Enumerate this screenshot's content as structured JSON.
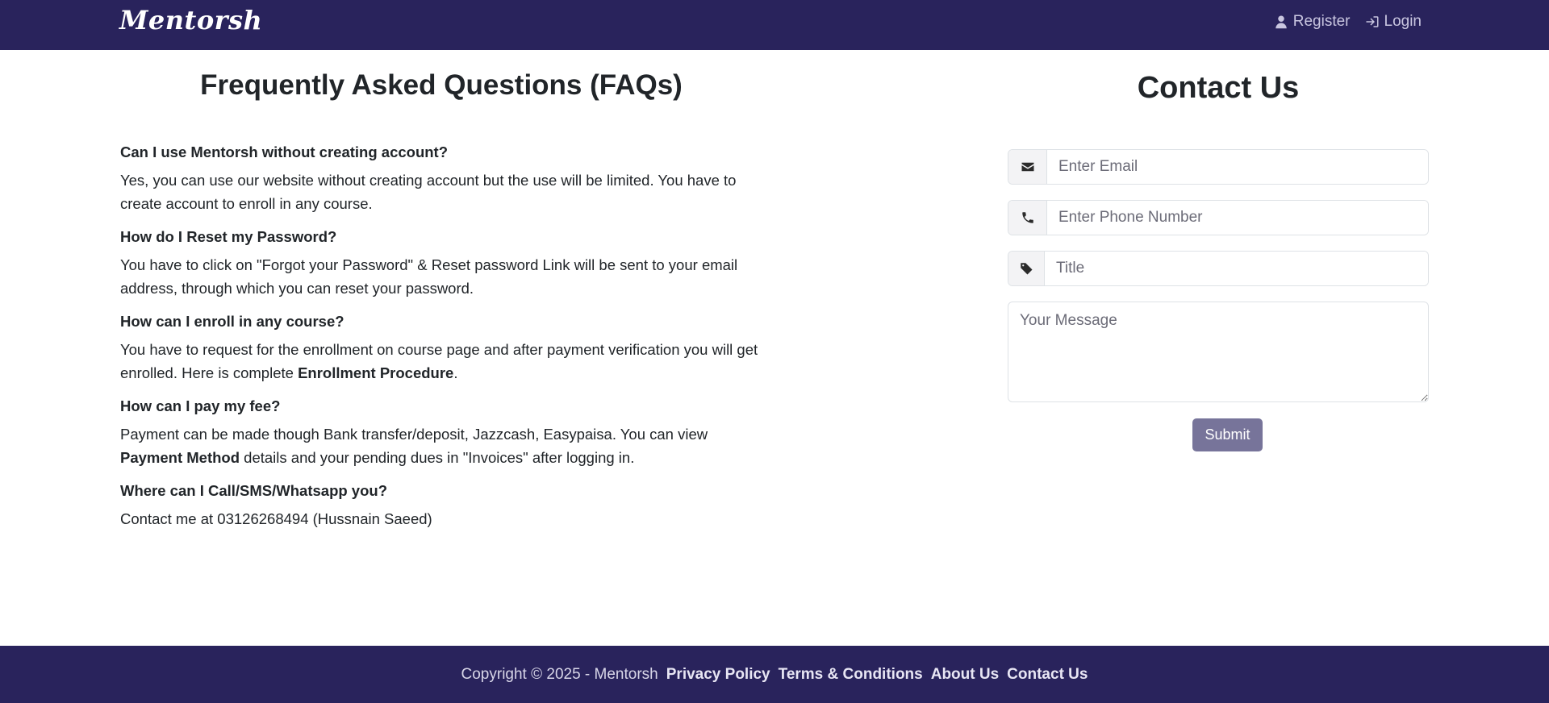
{
  "navbar": {
    "brand": "Mentorsh",
    "register_label": "Register",
    "login_label": "Login"
  },
  "faq": {
    "title": "Frequently Asked Questions (FAQs)",
    "items": [
      {
        "question": "Can I use Mentorsh without creating account?",
        "answer": "Yes, you can use our website without creating account but the use will be limited. You have to create account to enroll in any course."
      },
      {
        "question": "How do I Reset my Password?",
        "answer": "You have to click on \"Forgot your Password\" & Reset password Link will be sent to your email address, through which you can reset your password."
      },
      {
        "question": "How can I enroll in any course?",
        "answer_prefix": "You have to request for the enrollment on course page and after payment verification you will get enrolled. Here is complete ",
        "answer_link": "Enrollment Procedure",
        "answer_suffix": "."
      },
      {
        "question": "How can I pay my fee?",
        "answer_prefix": "Payment can be made though Bank transfer/deposit, Jazzcash, Easypaisa. You can view ",
        "answer_link": "Payment Method",
        "answer_suffix": " details and your pending dues in \"Invoices\" after logging in."
      },
      {
        "question": "Where can I Call/SMS/Whatsapp you?",
        "answer": "Contact me at 03126268494 (Hussnain Saeed)"
      }
    ]
  },
  "contact": {
    "title": "Contact Us",
    "email_placeholder": "Enter Email",
    "phone_placeholder": "Enter Phone Number",
    "title_placeholder": "Title",
    "message_placeholder": "Your Message",
    "submit_label": "Submit"
  },
  "footer": {
    "copyright": "Copyright © 2025 - Mentorsh",
    "links": [
      "Privacy Policy",
      "Terms & Conditions",
      "About Us",
      "Contact Us"
    ]
  },
  "colors": {
    "navbar_bg": "#29235c",
    "submit_bg": "#77749a"
  },
  "icons": {
    "register": "user-icon",
    "login": "sign-in-icon",
    "email": "envelope-icon",
    "phone": "phone-icon",
    "title": "tag-icon"
  }
}
